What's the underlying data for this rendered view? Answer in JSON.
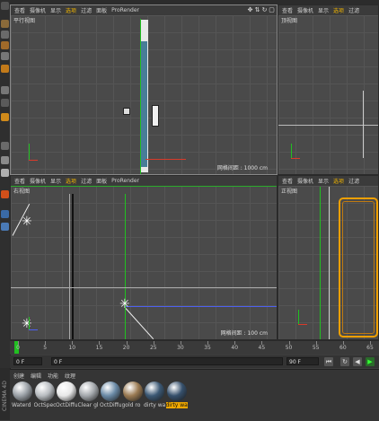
{
  "viewports": {
    "top_left": {
      "menu": [
        "查看",
        "摄像机",
        "显示",
        "选项",
        "过滤",
        "面板",
        "ProRender"
      ],
      "selected_menu": "选项",
      "name": "平行视图",
      "scale": "网格间距 : 1000 cm"
    },
    "top_right": {
      "menu": [
        "查看",
        "摄像机",
        "显示",
        "选项",
        "过滤"
      ],
      "selected_menu": "选项",
      "name": "顶视图"
    },
    "bottom_left": {
      "menu": [
        "查看",
        "摄像机",
        "显示",
        "选项",
        "过滤",
        "面板",
        "ProRender"
      ],
      "selected_menu": "选项",
      "name": "右视图",
      "scale": "网格间距 : 100 cm"
    },
    "bottom_right": {
      "menu": [
        "查看",
        "摄像机",
        "显示",
        "选项",
        "过滤"
      ],
      "selected_menu": "选项",
      "name": "正视图"
    }
  },
  "timeline": {
    "ticks": [
      "0",
      "5",
      "10",
      "15",
      "20",
      "25",
      "30",
      "35",
      "40",
      "45",
      "50",
      "55",
      "60",
      "65"
    ],
    "start_field": "0 F",
    "current_field": "0 F",
    "end_field": "90 F",
    "end_field_right": "90 F"
  },
  "materials": {
    "tabs": [
      "创建",
      "编辑",
      "功能",
      "纹理"
    ],
    "items": [
      {
        "label": "Waterd",
        "color": "#9aa0a6"
      },
      {
        "label": "OctSpec",
        "color": "#b8bcc0"
      },
      {
        "label": "OctDiffu",
        "color": "#e8e8e8"
      },
      {
        "label": "Clear gl",
        "color": "#a4a8ac"
      },
      {
        "label": "OctDiffu",
        "color": "#6a8aa6"
      },
      {
        "label": "gold ro",
        "color": "#9a7a52"
      },
      {
        "label": "dirty wa",
        "color": "#3b5874"
      },
      {
        "label": "dirty wa",
        "color": "#36506c"
      }
    ],
    "selected_index": 7
  },
  "brand": "CINEMA 4D",
  "colors": {
    "accent": "#f0b400",
    "axis_x": "#d93a2a",
    "axis_y": "#21c021",
    "axis_z": "#4d60f0"
  }
}
